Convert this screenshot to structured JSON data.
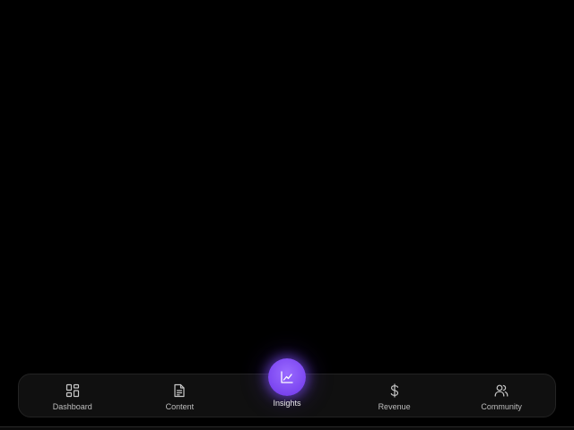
{
  "nav": {
    "items": [
      {
        "id": "dashboard",
        "label": "Dashboard",
        "icon": "grid-icon"
      },
      {
        "id": "content",
        "label": "Content",
        "icon": "document-icon"
      },
      {
        "id": "insights",
        "label": "Insights",
        "icon": "line-chart-icon",
        "active": true
      },
      {
        "id": "revenue",
        "label": "Revenue",
        "icon": "dollar-icon"
      },
      {
        "id": "community",
        "label": "Community",
        "icon": "users-icon"
      }
    ]
  },
  "colors": {
    "background": "#000000",
    "nav_background": "#101010",
    "accent": "#7b45f0",
    "label": "#bdbdbd",
    "icon": "#c8c8c8"
  }
}
